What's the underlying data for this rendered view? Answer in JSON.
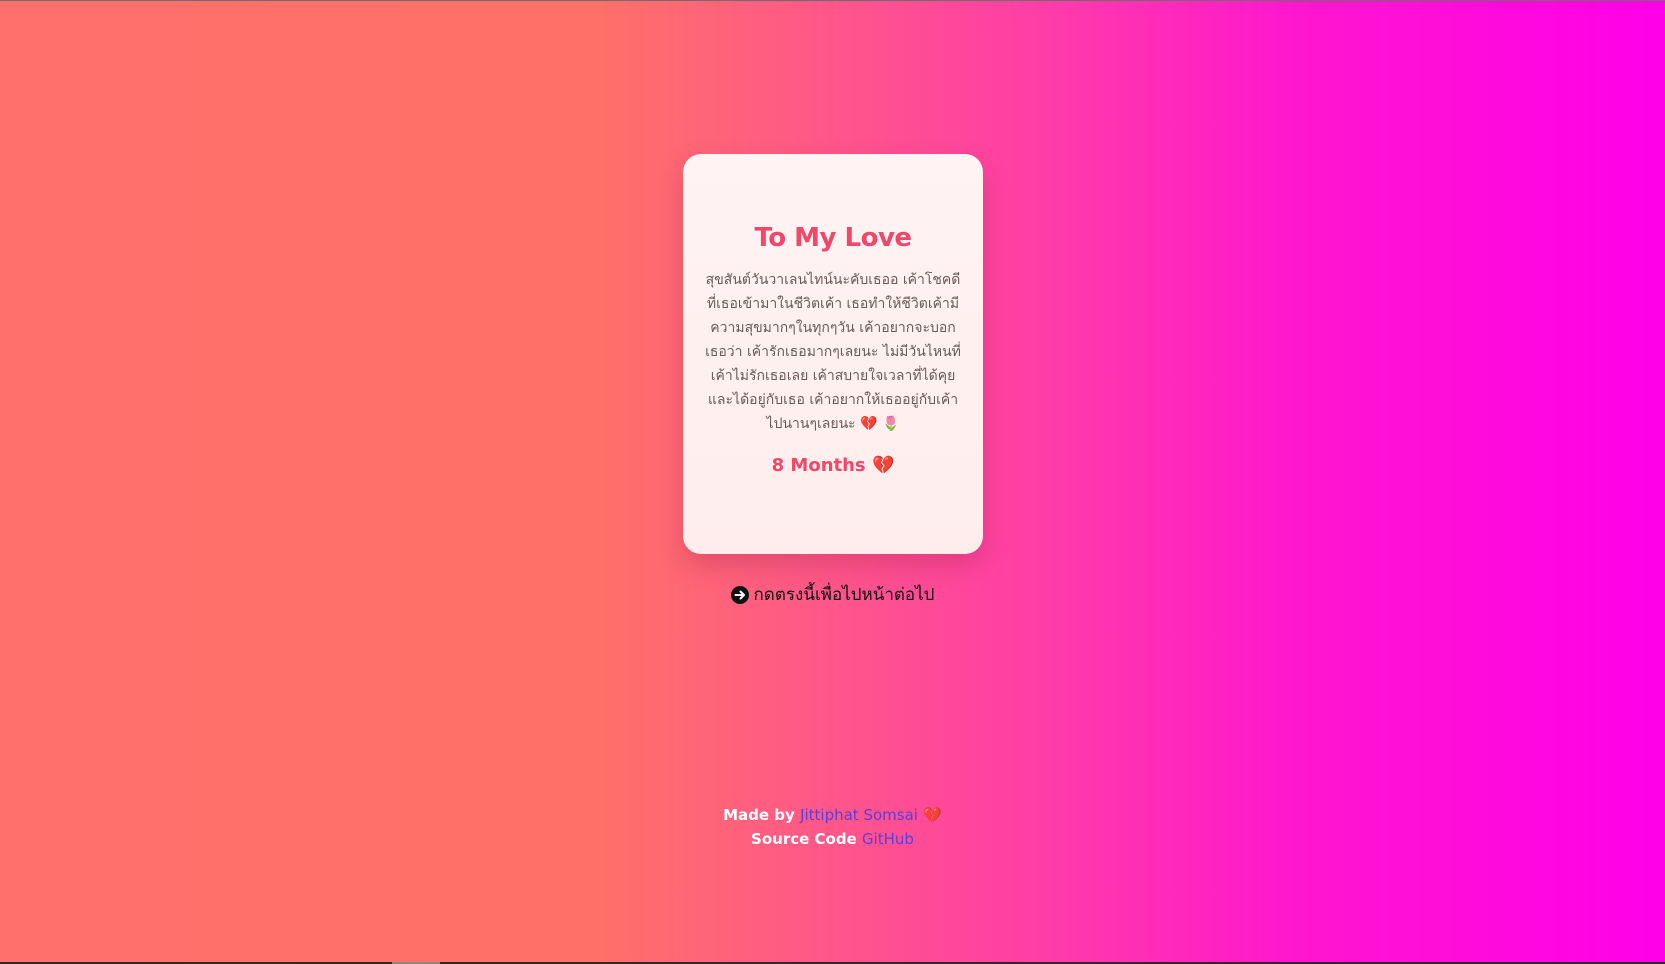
{
  "card": {
    "title": "To My Love",
    "message": "สุขสันต์วันวาเลนไทน์นะคับเธออ เค้าโชคดีที่เธอเข้ามาในชีวิตเค้า เธอทำให้ชีวิตเค้ามีความสุขมากๆในทุกๆวัน เค้าอยากจะบอกเธอว่า เค้ารักเธอมากๆเลยนะ ไม่มีวันไหนที่เค้าไม่รักเธอเลย เค้าสบายใจเวลาที่ได้คุยและได้อยู่กับเธอ เค้าอยากให้เธออยู่กับเค้าไปนานๆเลยนะ",
    "message_heart": "💔",
    "message_tulip": "🌷",
    "months_label": "8 Months",
    "months_heart": "💔"
  },
  "next": {
    "label": "กดตรงนี้เพื่อไปหน้าต่อไป",
    "icon": "arrow-circle-right-icon"
  },
  "footer": {
    "made_by_prefix": "Made by",
    "author_name": "Jittiphat Somsai",
    "author_heart": "💔",
    "source_prefix": "Source Code",
    "source_link": "GitHub"
  },
  "colors": {
    "title": "#f1476b",
    "link": "#5b3fd6",
    "gradient_start": "#ff6f6c",
    "gradient_end": "#ff00e8"
  }
}
